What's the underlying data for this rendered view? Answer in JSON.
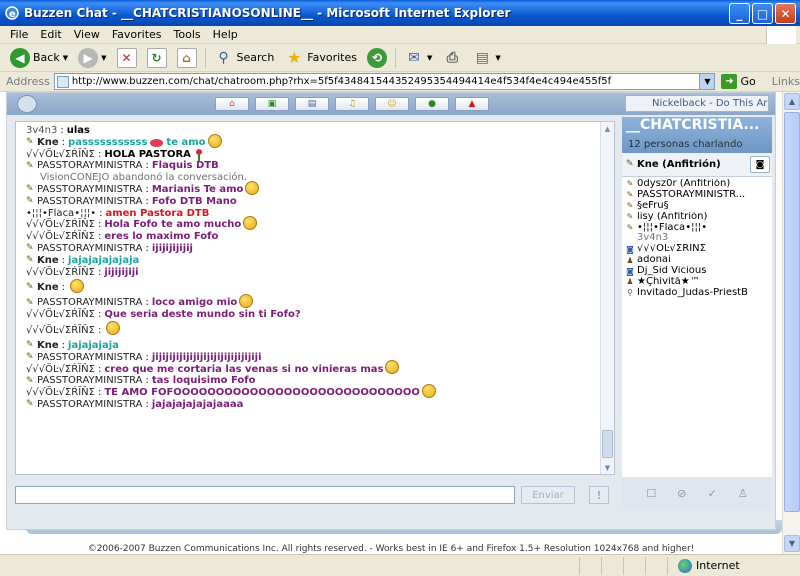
{
  "window": {
    "title": "Buzzen Chat - __CHATCRISTIANOSONLINE__ - Microsoft Internet Explorer"
  },
  "menu": [
    "File",
    "Edit",
    "View",
    "Favorites",
    "Tools",
    "Help"
  ],
  "toolbar": {
    "back": "Back",
    "search": "Search",
    "favorites": "Favorites"
  },
  "address": {
    "label": "Address",
    "url": "http://www.buzzen.com/chat/chatroom.php?rhx=5f5f434841544352495354494414e4f534f4e4c494e455f5f",
    "go": "Go",
    "links": "Links"
  },
  "chat": {
    "now_playing": "Nickelback - Do This Ar",
    "room_title": "__CHATCRISTIA...",
    "room_count": "12 personas charlando",
    "send_label": "Enviar",
    "more_label": "!",
    "lines": [
      {
        "nick": "3v4n3",
        "msg": "ulas",
        "color": "#000000",
        "nick_style": "gray",
        "icon": false
      },
      {
        "nick": "Kne",
        "msg": "passsssssssss",
        "after": "te amo",
        "color": "#1aa6a0",
        "nick_style": "bold",
        "icon": true,
        "lips": true,
        "smiley": true
      },
      {
        "nick": "√√√ÖĿ√ΣŔĪŇΣ",
        "msg": "HOLA PASTORA",
        "color": "#000000",
        "nick_style": "plain",
        "icon": false,
        "rose": true
      },
      {
        "nick": "PASSTORAYMINISTRA",
        "msg": "Flaquis DTB",
        "color": "#7b1e78",
        "nick_style": "plain",
        "icon": true
      },
      {
        "system": "VisionCONEJO abandonó la conversación."
      },
      {
        "nick": "PASSTORAYMINISTRA",
        "msg": "Marianis Te amo",
        "color": "#7b1e78",
        "nick_style": "plain",
        "icon": true,
        "smiley": true
      },
      {
        "nick": "PASSTORAYMINISTRA",
        "msg": "Fofo DTB Mano",
        "color": "#7b1e78",
        "nick_style": "plain",
        "icon": true
      },
      {
        "nick": "•¦¦¦•Flaca•¦¦¦•",
        "msg": "amen Pastora DTB",
        "color": "#d8141e",
        "nick_style": "plain",
        "icon": false
      },
      {
        "nick": "√√√ÖĿ√ΣŔĪŇΣ",
        "msg": "Hola Fofo te amo mucho",
        "color": "#7b1e78",
        "nick_style": "plain",
        "icon": false,
        "smiley": true
      },
      {
        "nick": "√√√ÖĿ√ΣŔĪŇΣ",
        "msg": "eres lo maximo Fofo",
        "color": "#7b1e78",
        "nick_style": "plain",
        "icon": false
      },
      {
        "nick": "PASSTORAYMINISTRA",
        "msg": "ijijijijijij",
        "color": "#7b1e78",
        "nick_style": "plain",
        "icon": true
      },
      {
        "nick": "Kne",
        "msg": "jajajajajajaja",
        "color": "#1aa6a0",
        "nick_style": "bold",
        "icon": true
      },
      {
        "nick": "√√√ÖĿ√ΣŔĪŇΣ",
        "msg": "jijijijiji",
        "color": "#7b1e78",
        "nick_style": "plain",
        "icon": false
      },
      {
        "nick": "Kne",
        "msg": "",
        "color": "#1aa6a0",
        "nick_style": "bold",
        "icon": true,
        "smiley": true,
        "tall": true
      },
      {
        "nick": "PASSTORAYMINISTRA",
        "msg": "loco amigo mio",
        "color": "#7b1e78",
        "nick_style": "plain",
        "icon": true,
        "smiley": true
      },
      {
        "nick": "√√√ÖĿ√ΣŔĪŇΣ",
        "msg": "Que seria deste mundo sin ti Fofo?",
        "color": "#7b1e78",
        "nick_style": "plain",
        "icon": false
      },
      {
        "nick": "√√√ÖĿ√ΣŔĪŇΣ",
        "msg": "",
        "color": "#7b1e78",
        "nick_style": "plain",
        "icon": false,
        "smiley": true,
        "tall": true
      },
      {
        "nick": "Kne",
        "msg": "jajajajaja",
        "color": "#1aa6a0",
        "nick_style": "bold",
        "icon": true
      },
      {
        "nick": "PASSTORAYMINISTRA",
        "msg": "jijijijijijijijijijijijijijijiji",
        "color": "#7b1e78",
        "nick_style": "plain",
        "icon": true
      },
      {
        "nick": "√√√ÖĿ√ΣŔĪŇΣ",
        "msg": "creo que me cortaria las venas si no vinieras mas",
        "color": "#7b1e78",
        "nick_style": "plain",
        "icon": false,
        "smiley": true
      },
      {
        "nick": "PASSTORAYMINISTRA",
        "msg": "tas loquisimo Fofo",
        "color": "#7b1e78",
        "nick_style": "plain",
        "icon": true
      },
      {
        "nick": "√√√ÖĿ√ΣŔĪŇΣ",
        "msg": "TE AMO FOFOOOOOOOOOOOOOOOOOOOOOOOOOOOOO",
        "color": "#7b1e78",
        "nick_style": "plain",
        "icon": false,
        "smiley": true
      },
      {
        "nick": "PASSTORAYMINISTRA",
        "msg": "jajajajajajajaaaa",
        "color": "#7b1e78",
        "nick_style": "plain",
        "icon": true
      }
    ],
    "current_user": "Kne (Anfitrión)",
    "users": [
      {
        "name": "0dysz0r (Anfitrión)",
        "icon": "wrench"
      },
      {
        "name": "PASSTORAYMINISTR...",
        "icon": "wrench"
      },
      {
        "name": "§eFru§",
        "icon": "wrench"
      },
      {
        "name": "lisy (Anfitrión)",
        "icon": "wrench"
      },
      {
        "name": "•¦¦¦•Flaca•¦¦¦•",
        "icon": "wrench"
      },
      {
        "name": "3v4n3",
        "icon": "none",
        "gray": true
      },
      {
        "name": "√√√ÖĿ√ΣŔĪŇΣ",
        "icon": "camera"
      },
      {
        "name": "adonai",
        "icon": "person"
      },
      {
        "name": "Dj_Sid Vicious",
        "icon": "camera"
      },
      {
        "name": "★Çhìvìtå★™",
        "icon": "person"
      },
      {
        "name": "Invitado_Judas-PriestB",
        "icon": "link"
      }
    ]
  },
  "footer": "©2006-2007 Buzzen Communications Inc. All rights reserved. - Works best in IE 6+ and Firefox 1.5+ Resolution 1024x768 and higher!",
  "status": {
    "zone": "Internet"
  }
}
